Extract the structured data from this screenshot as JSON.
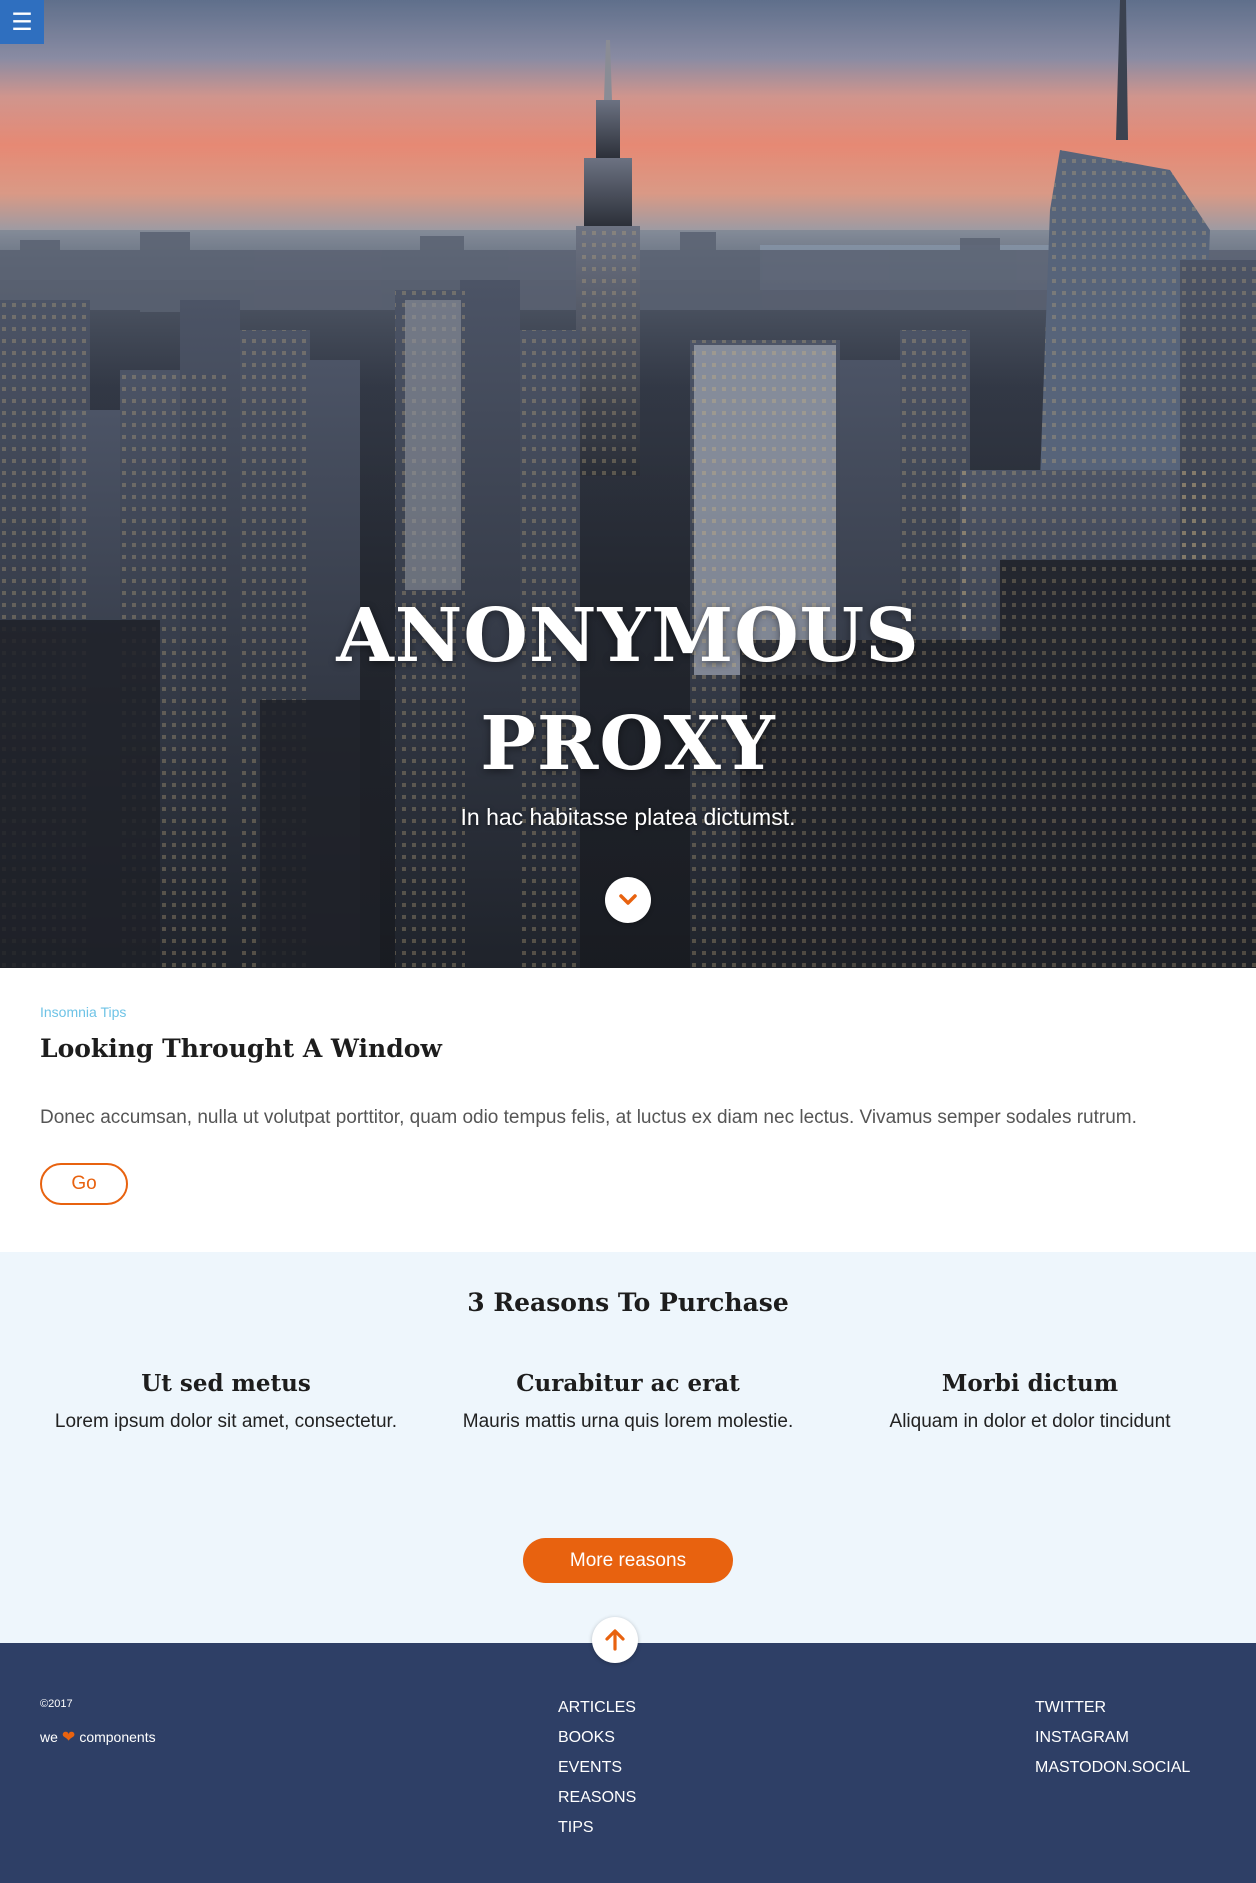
{
  "menu": {
    "icon": "hamburger-icon",
    "glyph": "☰"
  },
  "hero": {
    "title_line1": "ANONYMOUS",
    "title_line2": "PROXY",
    "subtitle": "In hac habitasse platea dictumst.",
    "scroll_icon": "chevron-down-icon"
  },
  "article": {
    "eyebrow": "Insomnia Tips",
    "title": "Looking Throught A Window",
    "body": "Donec accumsan, nulla ut volutpat porttitor, quam odio tempus felis, at luctus ex diam nec lectus. Vivamus semper sodales rutrum.",
    "button_label": "Go"
  },
  "reasons": {
    "title": "3 Reasons To Purchase",
    "items": [
      {
        "title": "Ut sed metus",
        "text": "Lorem ipsum dolor sit amet, consectetur."
      },
      {
        "title": "Curabitur ac erat",
        "text": "Mauris mattis urna quis lorem molestie."
      },
      {
        "title": "Morbi dictum",
        "text": "Aliquam in dolor et dolor tincidunt"
      }
    ],
    "button_label": "More reasons"
  },
  "footer": {
    "copyright": "©2017",
    "love_prefix": "we",
    "love_icon": "heart-icon",
    "love_suffix": "components",
    "nav_links": [
      "ARTICLES",
      "BOOKS",
      "EVENTS",
      "REASONS",
      "TIPS"
    ],
    "social_links": [
      "TWITTER",
      "INSTAGRAM",
      "MASTODON.SOCIAL"
    ],
    "up_icon": "arrow-up-icon"
  },
  "colors": {
    "accent": "#e8620f",
    "menu_blue": "#2f6fbf",
    "eyebrow": "#6ec3e6",
    "reasons_bg": "#eef6fc",
    "footer_bg": "#2e3f66"
  }
}
